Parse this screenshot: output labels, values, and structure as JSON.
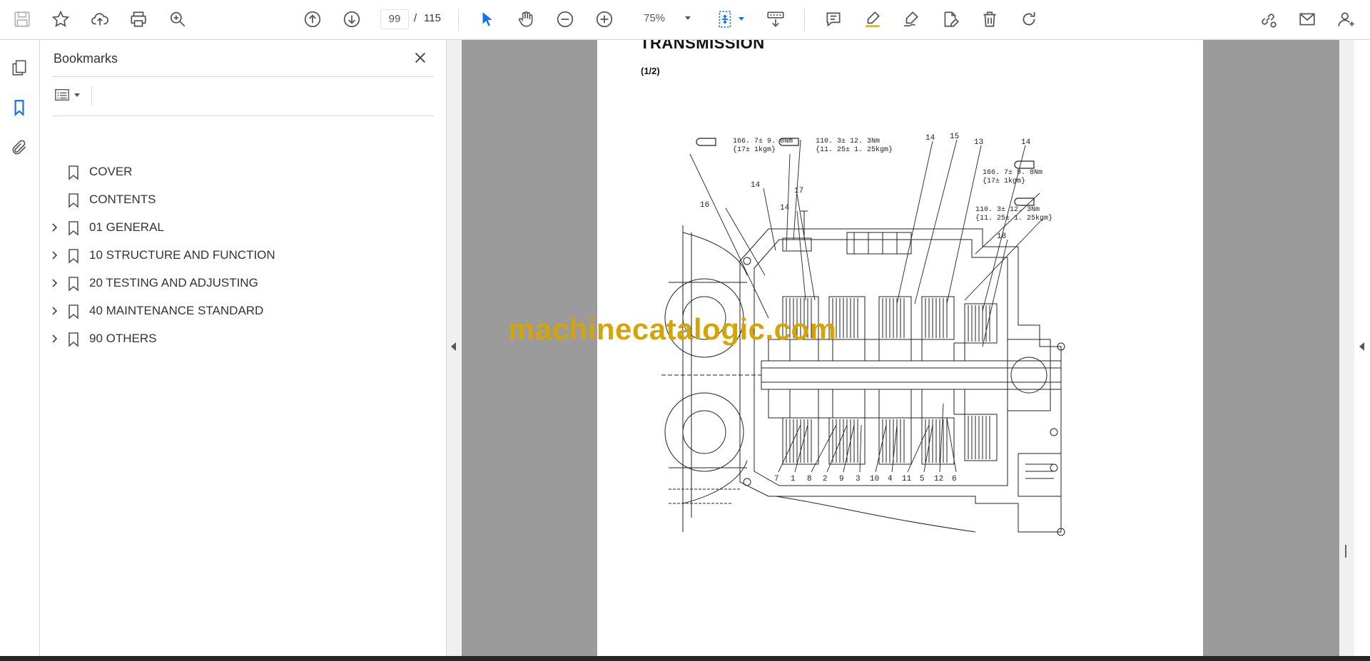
{
  "toolbar": {
    "page_current": "99",
    "page_separator": "/",
    "page_total": "115",
    "zoom": "75%",
    "icons": [
      "save-icon",
      "star-icon",
      "upload-cloud-icon",
      "print-icon",
      "search-zoom-icon",
      "page-up-icon",
      "page-down-icon",
      "select-cursor-icon",
      "hand-icon",
      "zoom-out-icon",
      "zoom-in-icon",
      "fit-page-icon",
      "scroll-mode-icon",
      "comment-icon",
      "highlight-icon",
      "draw-icon",
      "fill-sign-icon",
      "delete-icon",
      "rotate-icon",
      "share-link-icon",
      "mail-icon",
      "account-icon"
    ]
  },
  "bookmarks": {
    "title": "Bookmarks",
    "items": [
      {
        "label": "COVER",
        "expandable": false
      },
      {
        "label": "CONTENTS",
        "expandable": false
      },
      {
        "label": "01 GENERAL",
        "expandable": true
      },
      {
        "label": "10 STRUCTURE AND FUNCTION",
        "expandable": true
      },
      {
        "label": "20 TESTING AND ADJUSTING",
        "expandable": true
      },
      {
        "label": "40 MAINTENANCE STANDARD",
        "expandable": true
      },
      {
        "label": "90 OTHERS",
        "expandable": true
      }
    ]
  },
  "document": {
    "title": "TRANSMISSION",
    "subtitle": "(1/2)",
    "torque_labels": [
      "166. 7± 9. 8Nm",
      "{17± 1kgm}",
      "110. 3± 12. 3Nm",
      "{11. 25± 1. 25kgm}",
      "166. 7± 9. 8Nm",
      "{17± 1kgm}",
      "110. 3± 12. 3Nm",
      "{11. 25± 1. 25kgm}"
    ],
    "top_callouts": [
      "16",
      "14",
      "17",
      "14",
      "14",
      "15",
      "13",
      "14",
      "18"
    ],
    "bottom_callouts": [
      "7",
      "1",
      "8",
      "2",
      "9",
      "3",
      "10",
      "4",
      "11",
      "5",
      "12",
      "6"
    ]
  },
  "watermark": "machinecatalogic.com",
  "colors": {
    "accent_blue": "#1473e6",
    "viewer_bg": "#9b9b9b",
    "watermark": "#d4a409"
  }
}
